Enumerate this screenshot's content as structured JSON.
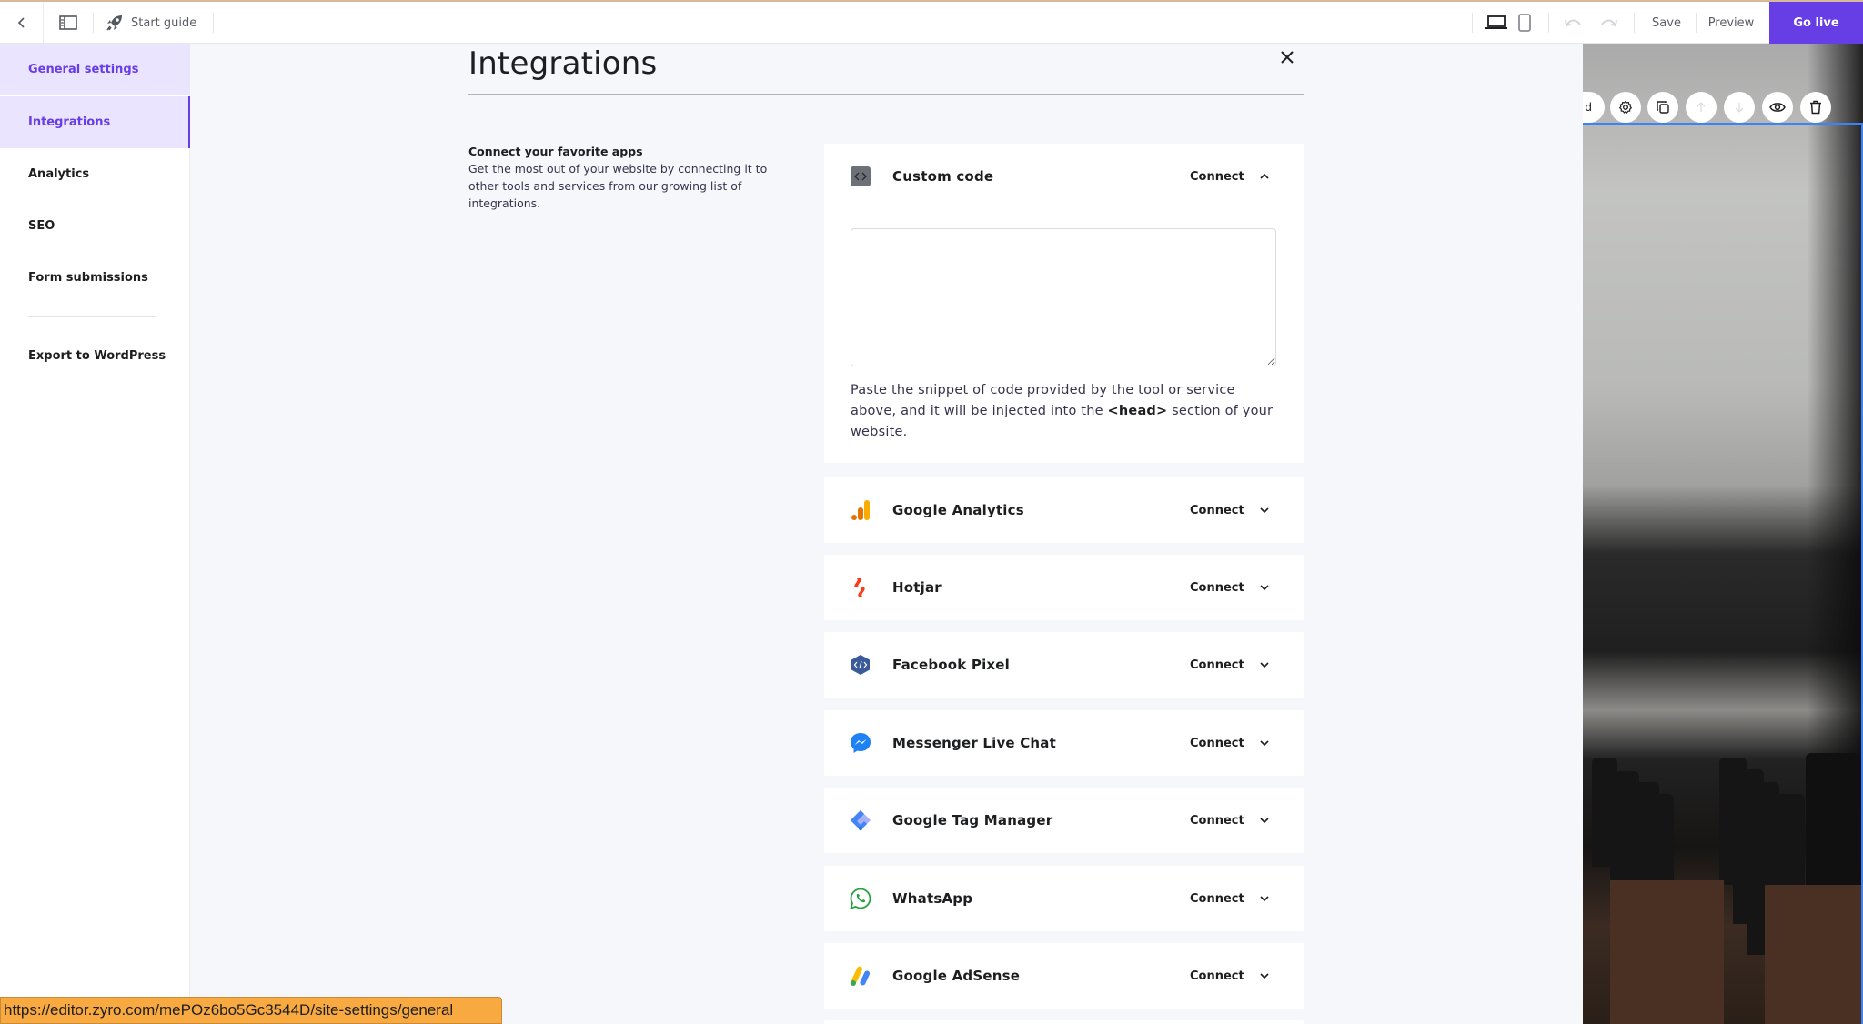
{
  "header": {
    "back_icon": "chevron-left-icon",
    "sidebar_toggle_icon": "sidebar-layout-icon",
    "start_guide_label": "Start guide",
    "start_guide_icon": "rocket-icon",
    "devices": [
      {
        "name": "desktop",
        "icon": "laptop-icon",
        "active": true
      },
      {
        "name": "mobile",
        "icon": "phone-icon",
        "active": false
      }
    ],
    "undo_icon": "undo-icon",
    "redo_icon": "redo-icon",
    "save_label": "Save",
    "preview_label": "Preview",
    "go_live_label": "Go live"
  },
  "sidebar": {
    "items": [
      {
        "label": "General settings",
        "active": true
      },
      {
        "label": "Integrations",
        "active": true,
        "selected": true
      },
      {
        "label": "Analytics"
      },
      {
        "label": "SEO"
      },
      {
        "label": "Form submissions"
      },
      {
        "label": "Export to WordPress"
      }
    ]
  },
  "main": {
    "title": "Integrations",
    "close_icon": "close-icon",
    "intro": {
      "title": "Connect your favorite apps",
      "description": "Get the most out of your website by connecting it to other tools and services from our growing list of integrations."
    },
    "custom_code": {
      "name": "Custom code",
      "icon": "code-icon",
      "connect_label": "Connect",
      "expanded": true,
      "textarea_value": "",
      "help_before": "Paste the snippet of code provided by the tool or service above, and it will be injected into the ",
      "help_bold": "<head>",
      "help_after": " section of your website."
    },
    "integrations": [
      {
        "name": "Google Analytics",
        "icon": "google-analytics-icon",
        "connect_label": "Connect"
      },
      {
        "name": "Hotjar",
        "icon": "hotjar-icon",
        "connect_label": "Connect"
      },
      {
        "name": "Facebook Pixel",
        "icon": "facebook-pixel-icon",
        "connect_label": "Connect"
      },
      {
        "name": "Messenger Live Chat",
        "icon": "messenger-icon",
        "connect_label": "Connect"
      },
      {
        "name": "Google Tag Manager",
        "icon": "google-tag-manager-icon",
        "connect_label": "Connect"
      },
      {
        "name": "WhatsApp",
        "icon": "whatsapp-icon",
        "connect_label": "Connect"
      },
      {
        "name": "Google AdSense",
        "icon": "google-adsense-icon",
        "connect_label": "Connect"
      }
    ]
  },
  "preview_toolbar": {
    "partial_label": "d",
    "buttons": [
      {
        "icon": "gear-icon",
        "enabled": true
      },
      {
        "icon": "duplicate-icon",
        "enabled": true
      },
      {
        "icon": "arrow-up-icon",
        "enabled": false
      },
      {
        "icon": "arrow-down-icon",
        "enabled": false
      },
      {
        "icon": "eye-icon",
        "enabled": true
      },
      {
        "icon": "trash-icon",
        "enabled": true
      }
    ]
  },
  "status_bar": {
    "url": "https://editor.zyro.com/mePOz6bo5Gc3544D/site-settings/general"
  },
  "colors": {
    "accent": "#673de6",
    "accent_light": "#ebe4ff",
    "selection_blue": "#3e82f7",
    "status_bar": "#f8a93f"
  }
}
